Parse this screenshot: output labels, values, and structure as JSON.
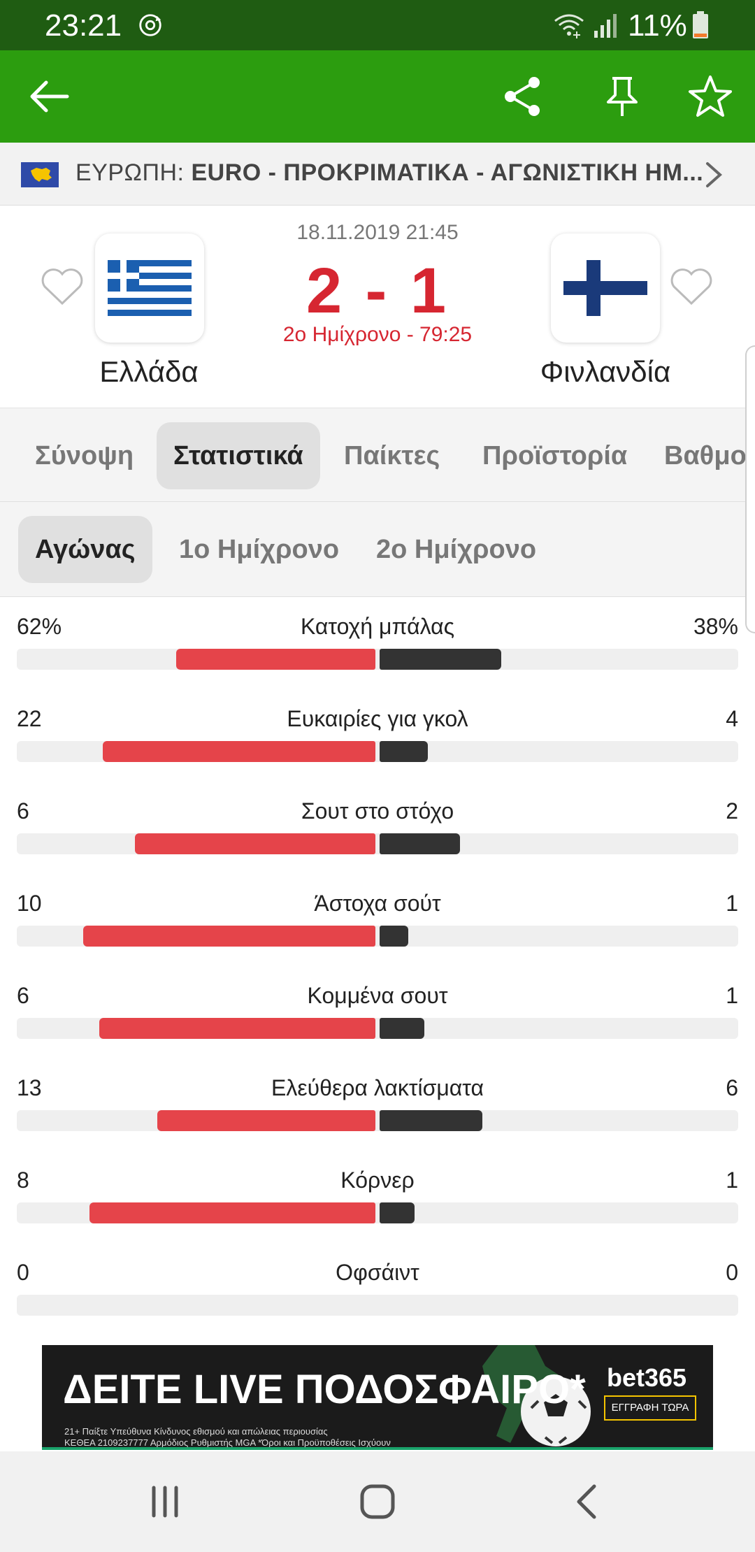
{
  "status_bar": {
    "time": "23:21",
    "battery": "11%",
    "icons": [
      "sync-icon",
      "wifi-icon",
      "signal-icon",
      "battery-icon"
    ]
  },
  "app_bar": {
    "icons": [
      "back-arrow-icon",
      "share-icon",
      "pin-icon",
      "star-icon"
    ]
  },
  "competition": {
    "region": "ΕΥΡΩΠΗ:",
    "name": "EURO - ΠΡΟΚΡΙΜΑΤΙΚΑ - ΑΓΩΝΙΣΤΙΚΗ ΗΜ..."
  },
  "match": {
    "datetime": "18.11.2019 21:45",
    "score": "2 - 1",
    "status": "2ο Ημίχρονο - 79:25",
    "home_team": "Ελλάδα",
    "away_team": "Φινλανδία",
    "accent_color": "#d62631"
  },
  "tabs": [
    {
      "label": "Σύνοψη"
    },
    {
      "label": "Στατιστικά"
    },
    {
      "label": "Παίκτες"
    },
    {
      "label": "Προϊστορία"
    },
    {
      "label": "Βαθμο"
    }
  ],
  "subtabs": [
    {
      "label": "Αγώνας"
    },
    {
      "label": "1ο Ημίχρονο"
    },
    {
      "label": "2ο Ημίχρονο"
    }
  ],
  "colors": {
    "home_bar": "#e5444a",
    "away_bar": "#333333",
    "app_green": "#2c9d0f",
    "status_green": "#1f5c12"
  },
  "stats": [
    {
      "label": "Κατοχή μπάλας",
      "home": "62%",
      "away": "38%",
      "home_fraction": 0.62,
      "away_fraction": 0.38
    },
    {
      "label": "Ευκαιρίες για γκολ",
      "home": "22",
      "away": "4",
      "home_fraction": 0.85,
      "away_fraction": 0.15
    },
    {
      "label": "Σουτ στο στόχο",
      "home": "6",
      "away": "2",
      "home_fraction": 0.75,
      "away_fraction": 0.25
    },
    {
      "label": "Άστοχα σούτ",
      "home": "10",
      "away": "1",
      "home_fraction": 0.91,
      "away_fraction": 0.09
    },
    {
      "label": "Κομμένα σουτ",
      "home": "6",
      "away": "1",
      "home_fraction": 0.86,
      "away_fraction": 0.14
    },
    {
      "label": "Ελεύθερα λακτίσματα",
      "home": "13",
      "away": "6",
      "home_fraction": 0.68,
      "away_fraction": 0.32
    },
    {
      "label": "Κόρνερ",
      "home": "8",
      "away": "1",
      "home_fraction": 0.89,
      "away_fraction": 0.11
    },
    {
      "label": "Οφσάιντ",
      "home": "0",
      "away": "0",
      "home_fraction": 0,
      "away_fraction": 0
    }
  ],
  "ad": {
    "headline": "ΔΕΙΤΕ LIVE ΠΟΔΟΣΦΑΙΡΟ*",
    "brand": "bet365",
    "cta": "ΕΓΓΡΑΦΗ ΤΩΡΑ",
    "fine_print_1": "21+  Παίξτε Υπεύθυνα     Κίνδυνος εθισμού και απώλειας περιουσίας",
    "fine_print_2": "ΚΕΘΕΑ 2109237777   Αρμόδιος Ρυθμιστής MGA     *Όροι και Προϋποθέσεις Ισχύουν"
  },
  "nav_bar": {
    "icons": [
      "recent-apps-icon",
      "home-icon",
      "back-icon"
    ]
  }
}
